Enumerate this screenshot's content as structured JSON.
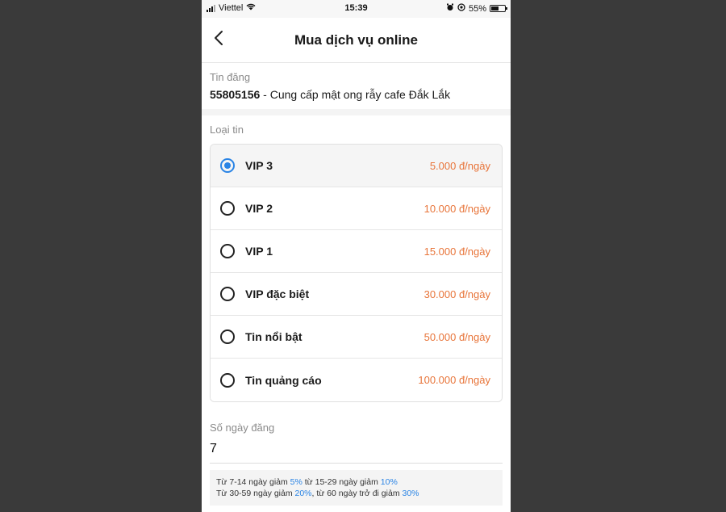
{
  "status": {
    "carrier": "Viettel",
    "time": "15:39",
    "battery": "55%",
    "battery_level": 0.55
  },
  "header": {
    "title": "Mua dịch vụ online",
    "back_icon": "chevron-left-icon"
  },
  "listing": {
    "label": "Tin đăng",
    "id": "55805156",
    "separator": " - ",
    "text": "Cung cấp mật ong rẫy cafe Đắk Lắk"
  },
  "type_section": {
    "label": "Loại tin",
    "options": [
      {
        "name": "VIP 3",
        "price": "5.000 đ/ngày",
        "selected": true
      },
      {
        "name": "VIP 2",
        "price": "10.000 đ/ngày",
        "selected": false
      },
      {
        "name": "VIP 1",
        "price": "15.000 đ/ngày",
        "selected": false
      },
      {
        "name": "VIP đặc biệt",
        "price": "30.000 đ/ngày",
        "selected": false
      },
      {
        "name": "Tin nổi bật",
        "price": "50.000 đ/ngày",
        "selected": false
      },
      {
        "name": "Tin quảng cáo",
        "price": "100.000 đ/ngày",
        "selected": false
      }
    ]
  },
  "days": {
    "label": "Số ngày đăng",
    "value": "7"
  },
  "discount": {
    "l1a": "Từ 7-14 ngày giảm ",
    "p1": "5%",
    "l1b": " từ 15-29 ngày giảm ",
    "p2": "10%",
    "l2a": "Từ 30-59 ngày giảm ",
    "p3": "20%",
    "l2b": ", từ 60 ngày trở đi giảm ",
    "p4": "30%"
  },
  "colors": {
    "accent": "#2a84e5",
    "price": "#e8753a",
    "background": "#3a3a3a"
  }
}
